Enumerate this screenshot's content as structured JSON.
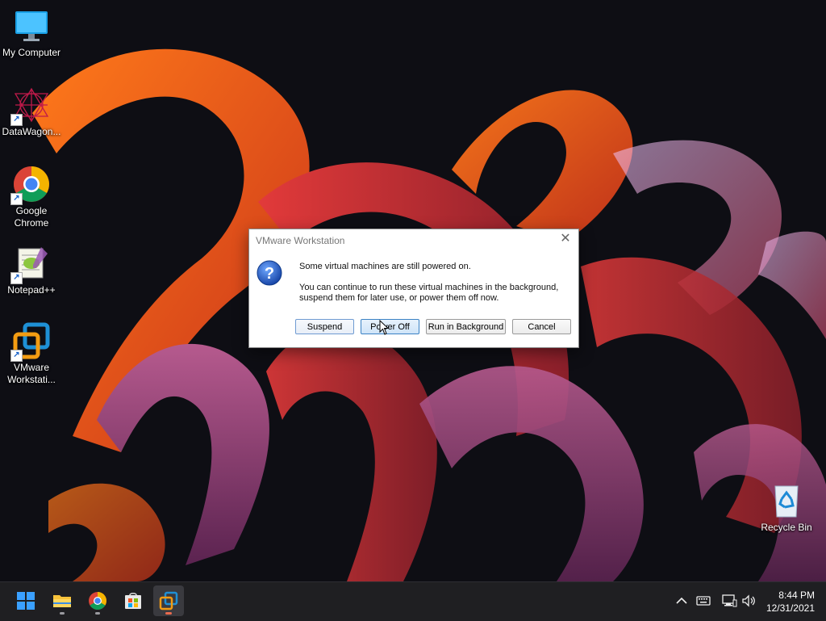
{
  "desktop": {
    "icons": [
      {
        "label": "My Computer",
        "icon": "monitor-icon"
      },
      {
        "label": "DataWagon...",
        "icon": "datawagon-icon"
      },
      {
        "label": "Google Chrome",
        "icon": "chrome-icon"
      },
      {
        "label": "Notepad++",
        "icon": "notepadpp-icon"
      },
      {
        "label": "VMware Workstati...",
        "icon": "vmware-icon"
      },
      {
        "label": "Recycle Bin",
        "icon": "recycle-bin-icon"
      }
    ]
  },
  "dialog": {
    "title": "VMware Workstation",
    "close": "✕",
    "icon": "question-icon",
    "message_primary": "Some virtual machines are still powered on.",
    "message_secondary": "You can continue to run these virtual machines in the background, suspend them for later use, or power them off now.",
    "buttons": {
      "suspend": "Suspend",
      "power_off": "Power Off",
      "run_background": "Run in Background",
      "cancel": "Cancel"
    }
  },
  "taskbar": {
    "items": [
      "start-icon",
      "file-explorer-icon",
      "chrome-icon",
      "store-icon",
      "vmware-icon"
    ],
    "tray": [
      "chevron-up-icon",
      "keyboard-icon",
      "network-icon",
      "volume-icon"
    ],
    "time": "8:44 PM",
    "date": "12/31/2021"
  }
}
